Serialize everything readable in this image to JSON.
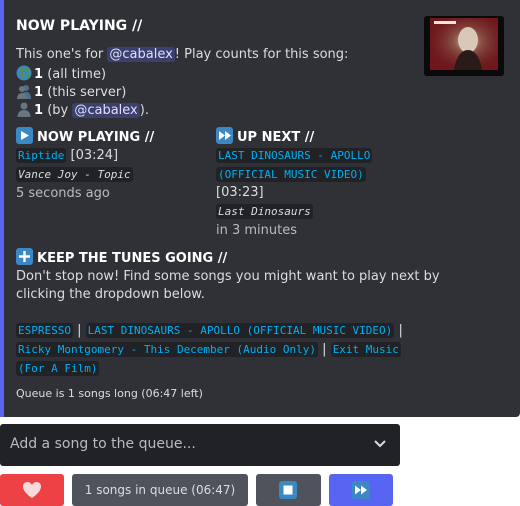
{
  "embed": {
    "title": "NOW PLAYING //",
    "intro_prefix": "This one's for ",
    "mention_user": "@cabalex",
    "intro_suffix": "! Play counts for this song:",
    "counts": [
      {
        "icon": "globe-icon",
        "count": "1",
        "label": "(all time)"
      },
      {
        "icon": "people-icon",
        "count": "1",
        "label": "(this server)"
      },
      {
        "icon": "person-icon",
        "count": "1",
        "label_prefix": "(by ",
        "mention": "@cabalex",
        "label_suffix": ")."
      }
    ],
    "now_playing": {
      "heading": "NOW PLAYING //",
      "song": "Riptide",
      "duration": "[03:24]",
      "artist": "Vance Joy - Topic",
      "time": "5 seconds ago"
    },
    "up_next": {
      "heading": "UP NEXT //",
      "song_line1": "LAST DINOSAURS - APOLLO",
      "song_line2": "(OFFICIAL MUSIC VIDEO)",
      "duration": "[03:23]",
      "artist": "Last Dinosaurs",
      "time": "in 3 minutes"
    },
    "keep_going": {
      "heading": "KEEP THE TUNES GOING //",
      "text_line1": "Don't stop now! Find some songs you might want to play next by",
      "text_line2": "clicking the dropdown below."
    },
    "suggestions": {
      "s1": "ESPRESSO",
      "s2": "LAST DINOSAURS - APOLLO (OFFICIAL MUSIC VIDEO)",
      "s3": "Ricky Montgomery - This December (Audio Only)",
      "s4a": "Exit Music",
      "s4b": "(For A Film)",
      "separator": "|"
    },
    "footer": "Queue is 1 songs long (06:47 left)",
    "accent_color": "#5865f2"
  },
  "select": {
    "placeholder": "Add a song to the queue..."
  },
  "buttons": {
    "like_color": "#ed4245",
    "queue_label": "1 songs in queue (06:47)",
    "stop_icon": "stop-icon",
    "skip_icon": "fast-forward-icon"
  }
}
